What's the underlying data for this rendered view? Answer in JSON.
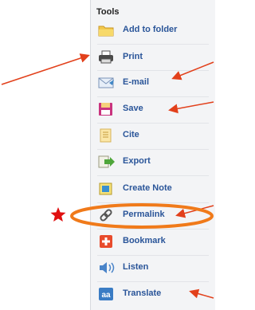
{
  "panel": {
    "title": "Tools",
    "items": [
      {
        "label": "Add to folder",
        "icon": "folder-icon"
      },
      {
        "label": "Print",
        "icon": "printer-icon"
      },
      {
        "label": "E-mail",
        "icon": "email-icon"
      },
      {
        "label": "Save",
        "icon": "save-icon"
      },
      {
        "label": "Cite",
        "icon": "cite-icon"
      },
      {
        "label": "Export",
        "icon": "export-icon"
      },
      {
        "label": "Create Note",
        "icon": "note-icon"
      },
      {
        "label": "Permalink",
        "icon": "link-icon"
      },
      {
        "label": "Bookmark",
        "icon": "bookmark-plus-icon"
      },
      {
        "label": "Listen",
        "icon": "speaker-icon"
      },
      {
        "label": "Translate",
        "icon": "translate-icon"
      }
    ]
  },
  "annotation": {
    "arrow_color": "#e2401b",
    "highlight_color": "#f07a1a",
    "star_color": "#e01010"
  },
  "colors": {
    "link": "#2a5599",
    "panel_bg": "#f3f4f6"
  },
  "icons": {
    "translate_glyph": "aa"
  }
}
